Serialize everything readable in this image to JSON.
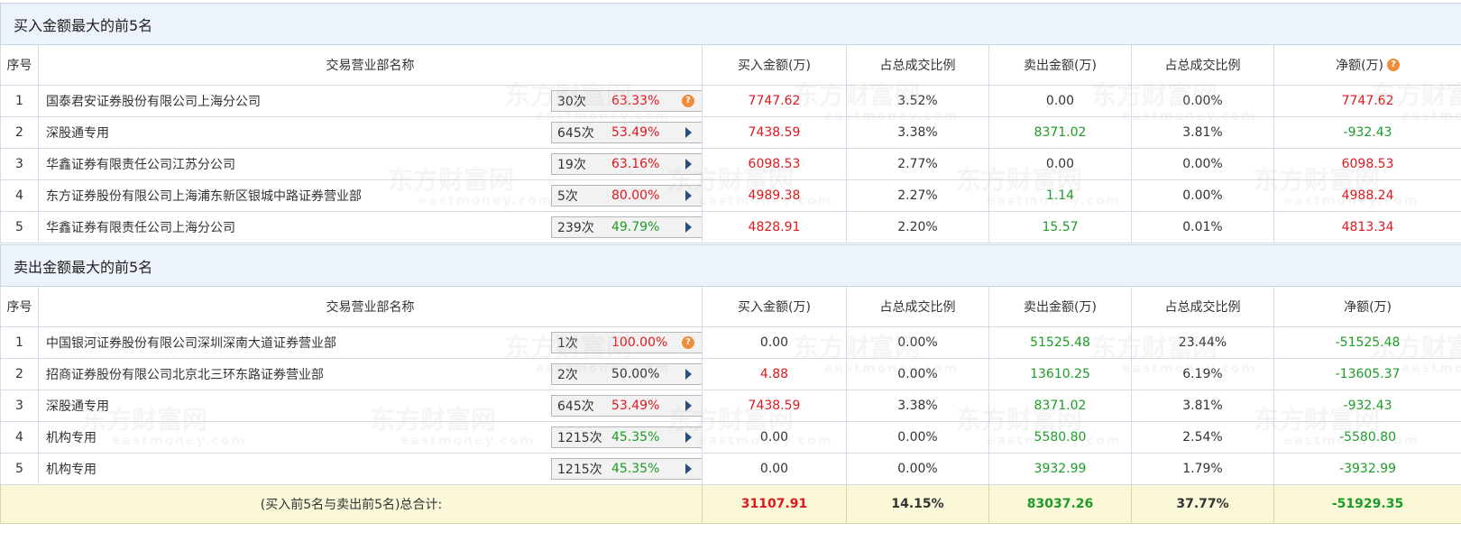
{
  "buy_section": {
    "title": "买入金额最大的前5名",
    "headers": {
      "seq": "序号",
      "name": "交易营业部名称",
      "buy": "买入金额(万)",
      "buy_pct": "占总成交比例",
      "sell": "卖出金额(万)",
      "sell_pct": "占总成交比例",
      "net": "净额(万)"
    },
    "rows": [
      {
        "seq": "1",
        "name": "国泰君安证券股份有限公司上海分公司",
        "count": "30次",
        "rate": "63.33%",
        "rate_color": "red",
        "action": "help",
        "buy": "7747.62",
        "buy_pct": "3.52%",
        "sell": "0.00",
        "sell_color": "dark",
        "sell_pct": "0.00%",
        "net": "7747.62",
        "net_color": "red"
      },
      {
        "seq": "2",
        "name": "深股通专用",
        "count": "645次",
        "rate": "53.49%",
        "rate_color": "red",
        "action": "arrow",
        "buy": "7438.59",
        "buy_pct": "3.38%",
        "sell": "8371.02",
        "sell_color": "green",
        "sell_pct": "3.81%",
        "net": "-932.43",
        "net_color": "green"
      },
      {
        "seq": "3",
        "name": "华鑫证券有限责任公司江苏分公司",
        "count": "19次",
        "rate": "63.16%",
        "rate_color": "red",
        "action": "arrow",
        "buy": "6098.53",
        "buy_pct": "2.77%",
        "sell": "0.00",
        "sell_color": "dark",
        "sell_pct": "0.00%",
        "net": "6098.53",
        "net_color": "red"
      },
      {
        "seq": "4",
        "name": "东方证券股份有限公司上海浦东新区银城中路证券营业部",
        "count": "5次",
        "rate": "80.00%",
        "rate_color": "red",
        "action": "arrow",
        "buy": "4989.38",
        "buy_pct": "2.27%",
        "sell": "1.14",
        "sell_color": "green",
        "sell_pct": "0.00%",
        "net": "4988.24",
        "net_color": "red"
      },
      {
        "seq": "5",
        "name": "华鑫证券有限责任公司上海分公司",
        "count": "239次",
        "rate": "49.79%",
        "rate_color": "green",
        "action": "arrow",
        "buy": "4828.91",
        "buy_pct": "2.20%",
        "sell": "15.57",
        "sell_color": "green",
        "sell_pct": "0.01%",
        "net": "4813.34",
        "net_color": "red"
      }
    ]
  },
  "sell_section": {
    "title": "卖出金额最大的前5名",
    "headers": {
      "seq": "序号",
      "name": "交易营业部名称",
      "buy": "买入金额(万)",
      "buy_pct": "占总成交比例",
      "sell": "卖出金额(万)",
      "sell_pct": "占总成交比例",
      "net": "净额(万)"
    },
    "rows": [
      {
        "seq": "1",
        "name": "中国银河证券股份有限公司深圳深南大道证券营业部",
        "count": "1次",
        "rate": "100.00%",
        "rate_color": "red",
        "action": "help",
        "buy": "0.00",
        "buy_color": "dark",
        "buy_pct": "0.00%",
        "sell": "51525.48",
        "sell_pct": "23.44%",
        "net": "-51525.48"
      },
      {
        "seq": "2",
        "name": "招商证券股份有限公司北京北三环东路证券营业部",
        "count": "2次",
        "rate": "50.00%",
        "rate_color": "dark",
        "action": "arrow",
        "buy": "4.88",
        "buy_color": "red",
        "buy_pct": "0.00%",
        "sell": "13610.25",
        "sell_pct": "6.19%",
        "net": "-13605.37"
      },
      {
        "seq": "3",
        "name": "深股通专用",
        "count": "645次",
        "rate": "53.49%",
        "rate_color": "red",
        "action": "arrow",
        "buy": "7438.59",
        "buy_color": "red",
        "buy_pct": "3.38%",
        "sell": "8371.02",
        "sell_pct": "3.81%",
        "net": "-932.43"
      },
      {
        "seq": "4",
        "name": "机构专用",
        "count": "1215次",
        "rate": "45.35%",
        "rate_color": "green",
        "action": "arrow",
        "buy": "0.00",
        "buy_color": "dark",
        "buy_pct": "0.00%",
        "sell": "5580.80",
        "sell_pct": "2.54%",
        "net": "-5580.80"
      },
      {
        "seq": "5",
        "name": "机构专用",
        "count": "1215次",
        "rate": "45.35%",
        "rate_color": "green",
        "action": "arrow",
        "buy": "0.00",
        "buy_color": "dark",
        "buy_pct": "0.00%",
        "sell": "3932.99",
        "sell_pct": "1.79%",
        "net": "-3932.99"
      }
    ]
  },
  "totals": {
    "label": "(买入前5名与卖出前5名)总合计:",
    "buy": "31107.91",
    "buy_pct": "14.15%",
    "sell": "83037.26",
    "sell_pct": "37.77%",
    "net": "-51929.35"
  },
  "watermark": {
    "cn": "东方财富网",
    "en": "eastmoney.com"
  },
  "colors": {
    "red": "#e0171d",
    "green": "#1c9c27",
    "header_bg": "#ecf3fb",
    "total_bg": "#fbf8d9",
    "help_icon": "#f08c3a",
    "arrow_icon": "#2a4f7c"
  }
}
